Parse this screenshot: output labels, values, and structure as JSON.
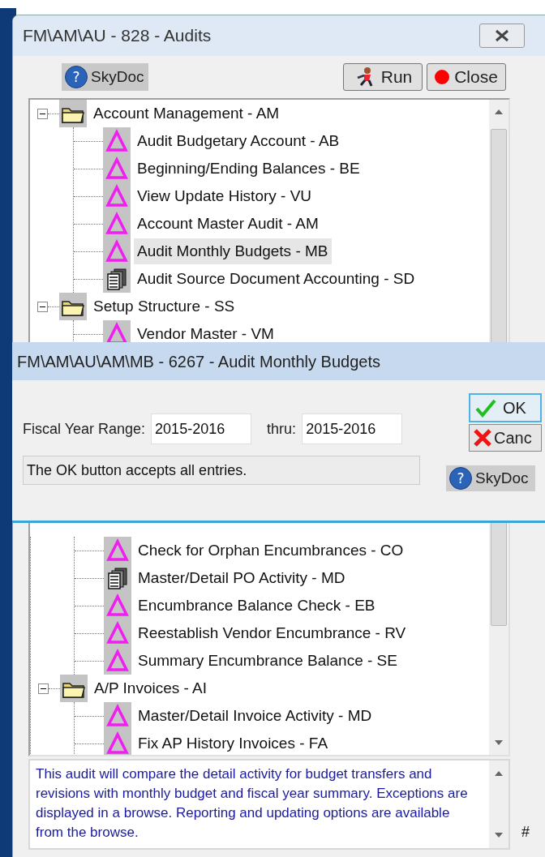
{
  "window": {
    "title": "FM\\AM\\AU - 828 - Audits"
  },
  "toolbar": {
    "help_glyph": "?",
    "skydoc": "SkyDoc",
    "run": "Run",
    "close": "Close"
  },
  "tree": [
    {
      "label": "Account Management - AM",
      "kind": "folder",
      "expanded": true,
      "selected": false,
      "children": [
        {
          "label": "Audit Budgetary Account - AB",
          "kind": "audit",
          "selected": false
        },
        {
          "label": "Beginning/Ending Balances - BE",
          "kind": "audit",
          "selected": false
        },
        {
          "label": "View Update History - VU",
          "kind": "audit",
          "selected": false
        },
        {
          "label": "Account Master Audit - AM",
          "kind": "audit",
          "selected": false
        },
        {
          "label": "Audit Monthly Budgets - MB",
          "kind": "audit",
          "selected": true
        },
        {
          "label": "Audit Source Document Accounting - SD",
          "kind": "report",
          "selected": false
        }
      ]
    },
    {
      "label": "Setup Structure - SS",
      "kind": "folder",
      "expanded": true,
      "selected": false,
      "children": [
        {
          "label": "Vendor Master - VM",
          "kind": "audit",
          "selected": false
        }
      ]
    }
  ],
  "tree_continued": {
    "children": [
      {
        "children": [
          {
            "label": "Check for Orphan Encumbrances - CO",
            "kind": "audit",
            "selected": false
          },
          {
            "label": "Master/Detail PO Activity - MD",
            "kind": "report",
            "selected": false
          },
          {
            "label": "Encumbrance Balance Check - EB",
            "kind": "audit",
            "selected": false
          },
          {
            "label": "Reestablish Vendor Encumbrance - RV",
            "kind": "audit",
            "selected": false
          },
          {
            "label": "Summary Encumbrance Balance - SE",
            "kind": "audit",
            "selected": false
          }
        ]
      },
      {
        "label": "A/P Invoices - AI",
        "kind": "folder",
        "expanded": true,
        "selected": false,
        "children": [
          {
            "label": "Master/Detail Invoice Activity - MD",
            "kind": "audit",
            "selected": false
          },
          {
            "label": "Fix AP History Invoices - FA",
            "kind": "audit",
            "selected": false
          }
        ]
      }
    ]
  },
  "description": "This audit will compare the detail activity for budget transfers and revisions with monthly budget and fiscal year summary. Exceptions are displayed in a browse. Reporting and updating options are available from the browse.",
  "corner_mark": "#",
  "dialog": {
    "title": "FM\\AM\\AU\\AM\\MB - 6267 - Audit Monthly Budgets",
    "range_label": "Fiscal Year Range:",
    "from": "2015-2016",
    "thru_label": "thru:",
    "thru": "2015-2016",
    "ok": "OK",
    "cancel": "Canc",
    "status": "The OK button accepts all entries.",
    "help_glyph": "?",
    "skydoc": "SkyDoc"
  }
}
